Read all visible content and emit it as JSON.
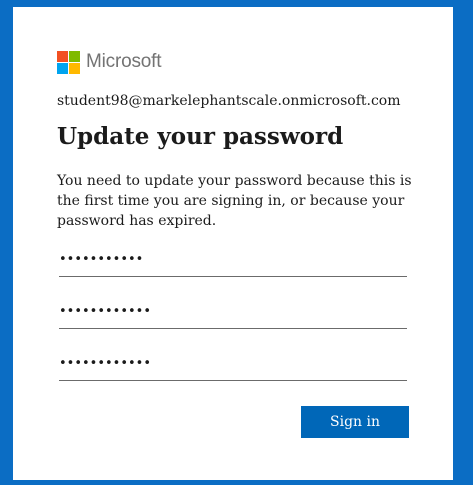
{
  "brand": {
    "name": "Microsoft",
    "logo_colors": [
      "#f25022",
      "#7fba00",
      "#00a4ef",
      "#ffb900"
    ]
  },
  "account": {
    "email": "student98@markelephantscale.onmicrosoft.com"
  },
  "heading": "Update your password",
  "description": "You need to update your password because this is the first time you are signing in, or because your password has expired.",
  "fields": [
    {
      "value": "•••••••••••"
    },
    {
      "value": "••••••••••••"
    },
    {
      "value": "••••••••••••"
    }
  ],
  "actions": {
    "submit_label": "Sign in"
  },
  "colors": {
    "background": "#0b6dc4",
    "card": "#ffffff",
    "accent": "#0067b8"
  }
}
